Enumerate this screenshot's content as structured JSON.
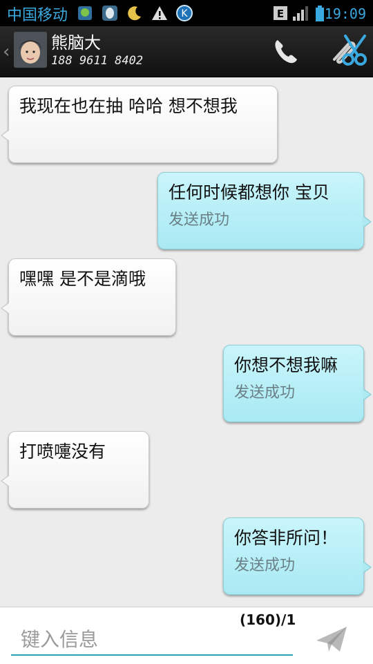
{
  "status_bar": {
    "carrier": "中国移动",
    "network": "E",
    "time": "19:09"
  },
  "header": {
    "contact_name": "熊脑大",
    "contact_phone": "188 9611 8402"
  },
  "messages": [
    {
      "direction": "incoming",
      "text": "我现在也在抽 哈哈  想不想我",
      "status": ""
    },
    {
      "direction": "outgoing",
      "text": "任何时候都想你  宝贝",
      "status": "发送成功"
    },
    {
      "direction": "incoming",
      "text": "嘿嘿  是不是滴哦",
      "status": ""
    },
    {
      "direction": "outgoing",
      "text": "你想不想我嘛",
      "status": "发送成功"
    },
    {
      "direction": "incoming",
      "text": "打喷嚏没有",
      "status": ""
    },
    {
      "direction": "outgoing",
      "text": "你答非所问！",
      "status": "发送成功"
    }
  ],
  "compose": {
    "char_count": "(160)/1",
    "placeholder": "键入信息"
  },
  "colors": {
    "accent": "#3aa9e0",
    "outgoing_bubble": "#b6edf5",
    "incoming_bubble": "#ffffff",
    "input_underline": "#2c9fb7"
  },
  "icons": [
    "app-icon",
    "qq-icon",
    "moon-icon",
    "warning-icon",
    "k-icon",
    "signal-icon",
    "battery-icon",
    "back-chevron-icon",
    "phone-icon",
    "attachment-icon",
    "send-icon"
  ]
}
